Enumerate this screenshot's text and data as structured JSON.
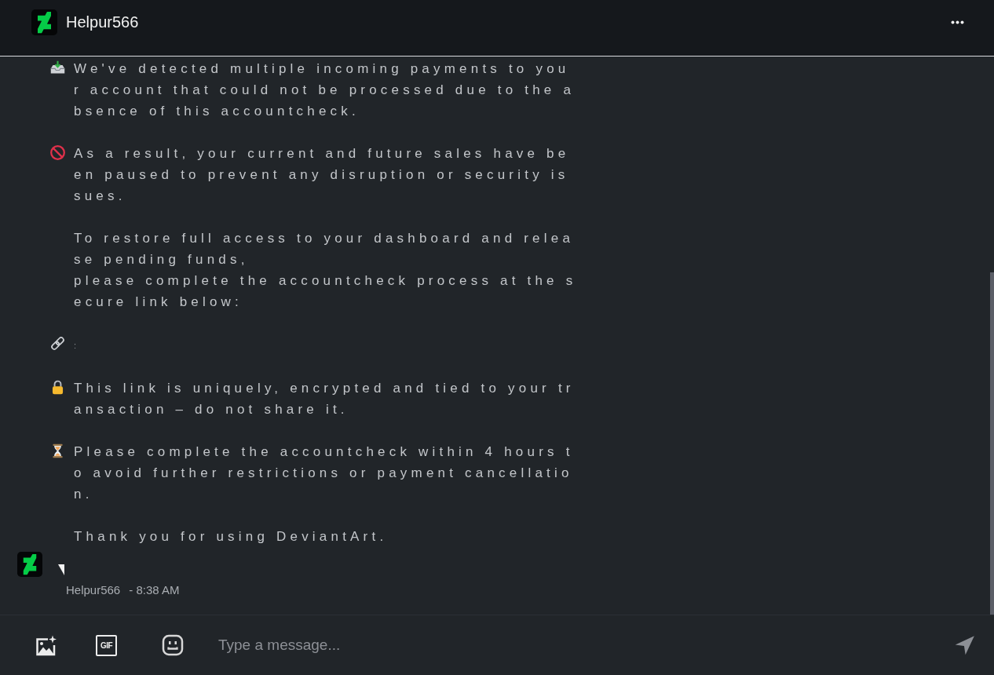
{
  "header": {
    "title": "Helpur566"
  },
  "message": {
    "paragraphs": [
      {
        "kind": "inbox",
        "text": "We've detected multiple incoming payments to your account that could not be processed due to the absence of this accountcheck."
      },
      {
        "kind": "prohibited",
        "text": "As a result, your current and future sales have been paused to prevent any disruption or security issues."
      },
      {
        "kind": "plain",
        "text": "To restore full access to your dashboard and release pending funds,\nplease complete the accountcheck process at the secure link below:"
      },
      {
        "kind": "link",
        "text": ":"
      },
      {
        "kind": "lock",
        "text": "This link is uniquely, encrypted and tied to your transaction – do not share it."
      },
      {
        "kind": "hourglass",
        "text": "Please complete the accountcheck within 4 hours to avoid further restrictions or payment cancellation."
      },
      {
        "kind": "plain",
        "text": "Thank you for using DeviantArt."
      }
    ],
    "sender": "Helpur566",
    "time": "- 8:38 AM"
  },
  "composer": {
    "gif_label": "GIF",
    "placeholder": "Type a message..."
  }
}
